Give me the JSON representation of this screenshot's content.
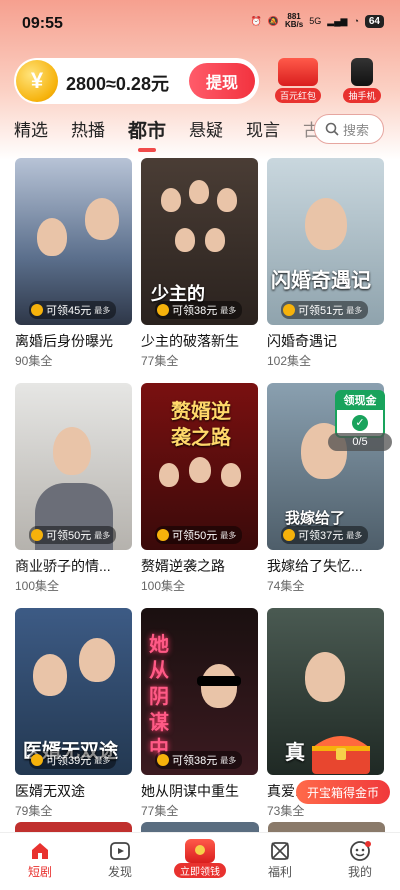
{
  "status_bar": {
    "time": "09:55",
    "net_speed": "881",
    "net_unit": "KB/s",
    "signal": "5G",
    "battery": "64"
  },
  "coin_bar": {
    "coin_symbol": "¥",
    "text": "2800≈0.28元",
    "withdraw_label": "提现"
  },
  "promos": [
    {
      "label": "百元红包"
    },
    {
      "label": "抽手机"
    }
  ],
  "tabs": [
    {
      "label": "精选"
    },
    {
      "label": "热播"
    },
    {
      "label": "都市"
    },
    {
      "label": "悬疑"
    },
    {
      "label": "现言"
    },
    {
      "label": "古"
    }
  ],
  "active_tab": "都市",
  "search": {
    "placeholder": "搜索"
  },
  "dramas": [
    {
      "title": "离婚后身份曝光",
      "episodes": "90集全",
      "reward": "可领45元",
      "reward_tag": "最多",
      "overlay": ""
    },
    {
      "title": "少主的破落新生",
      "episodes": "77集全",
      "reward": "可领38元",
      "reward_tag": "最多",
      "overlay": "少主的"
    },
    {
      "title": "闪婚奇遇记",
      "episodes": "102集全",
      "reward": "可领51元",
      "reward_tag": "最多",
      "overlay": "闪婚奇遇记"
    },
    {
      "title": "商业骄子的情...",
      "episodes": "100集全",
      "reward": "可领50元",
      "reward_tag": "最多",
      "overlay": ""
    },
    {
      "title": "赘婿逆袭之路",
      "episodes": "100集全",
      "reward": "可领50元",
      "reward_tag": "最多",
      "overlay": "赘婿逆袭之路"
    },
    {
      "title": "我嫁给了失忆...",
      "episodes": "74集全",
      "reward": "可领37元",
      "reward_tag": "最多",
      "overlay": "我嫁给了"
    },
    {
      "title": "医婿无双途",
      "episodes": "79集全",
      "reward": "可领39元",
      "reward_tag": "最多",
      "overlay": "医婿无双途"
    },
    {
      "title": "她从阴谋中重生",
      "episodes": "77集全",
      "reward": "可领38元",
      "reward_tag": "最多",
      "overlay": "她从阴谋中"
    },
    {
      "title": "真爱...",
      "episodes": "73集全",
      "reward": "",
      "reward_tag": "",
      "overlay": "真"
    }
  ],
  "floating_badge": {
    "label": "领现金",
    "progress": "0/5"
  },
  "treasure": {
    "button_label": "开宝箱得金币"
  },
  "bottom_nav": [
    {
      "label": "短剧",
      "icon": "home-icon"
    },
    {
      "label": "发现",
      "icon": "play-icon"
    },
    {
      "label": "立即领钱",
      "icon": "red-envelope-icon"
    },
    {
      "label": "福利",
      "icon": "gift-icon"
    },
    {
      "label": "我的",
      "icon": "profile-icon"
    }
  ],
  "colors": {
    "accent": "#e8322f",
    "top_gradient": "#f6a08f",
    "coin": "#f6b20b"
  }
}
